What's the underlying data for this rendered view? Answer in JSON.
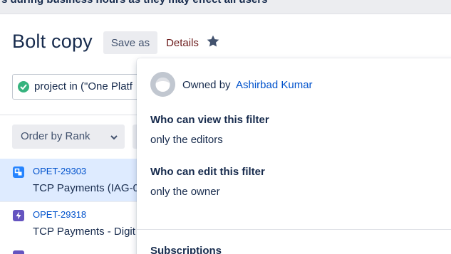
{
  "banner": {
    "text": "s during business hours as they may effect all users"
  },
  "header": {
    "title": "Bolt copy",
    "save_as_label": "Save as",
    "details_label": "Details",
    "star_icon": "star-icon"
  },
  "search": {
    "status_icon": "check-circle-icon",
    "query_text": "project in (\"One Platf"
  },
  "toolbar": {
    "order_label": "Order by Rank",
    "order_icon": "chevron-down-icon"
  },
  "issues": [
    {
      "key": "OPET-29303",
      "summary": "TCP Payments (IAG-0",
      "type_icon": "subtask-icon",
      "icon_color": "#2684ff",
      "selected": true
    },
    {
      "key": "OPET-29318",
      "summary": "TCP Payments - Digit",
      "type_icon": "epic-icon",
      "icon_color": "#6554c0",
      "selected": false
    }
  ],
  "details_popup": {
    "owned_by_label": "Owned by",
    "owner_name": "Ashirbad Kumar",
    "view_heading": "Who can view this filter",
    "view_value": "only the editors",
    "edit_heading": "Who can edit this filter",
    "edit_value": "only the owner",
    "subscriptions_heading": "Subscriptions"
  },
  "colors": {
    "accent_link": "#0052cc",
    "text": "#172b4d",
    "selected_row": "#deebff",
    "details_label": "#6b1a1a",
    "success": "#36b37e"
  }
}
